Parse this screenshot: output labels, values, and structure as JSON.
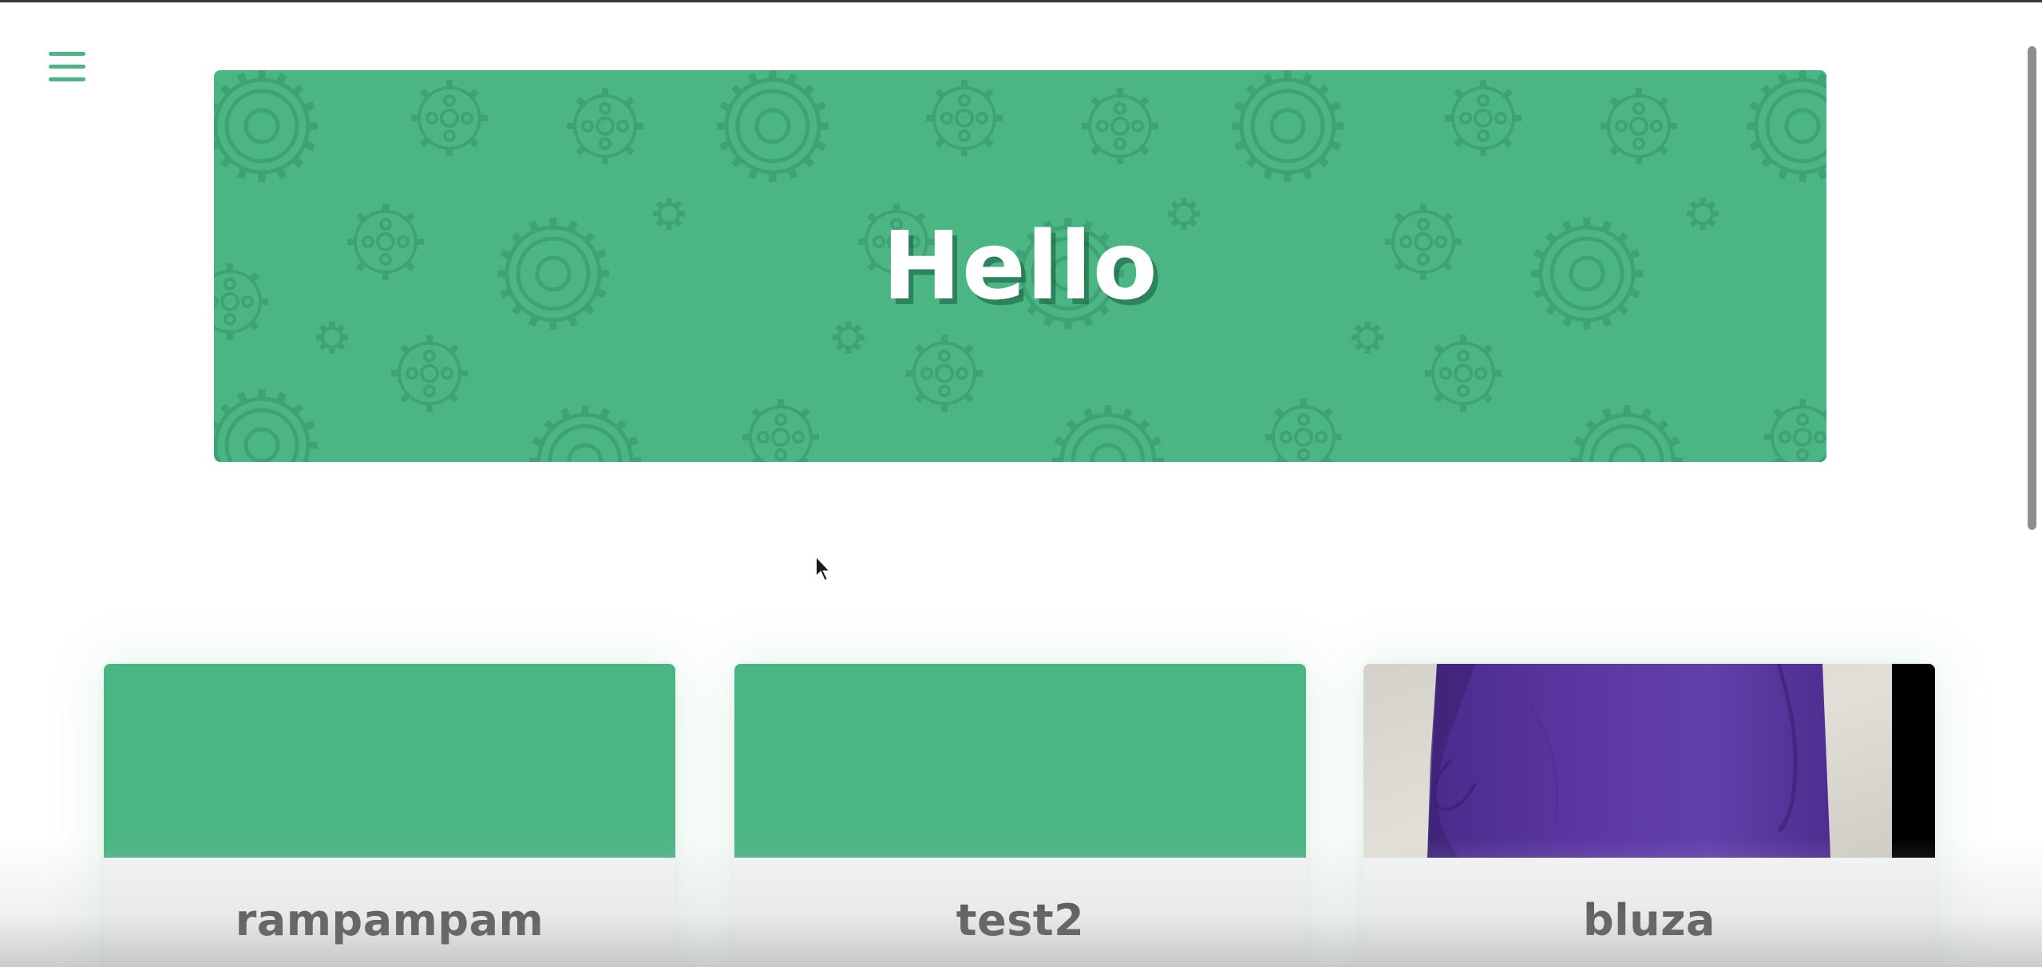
{
  "header": {
    "menu_icon": "hamburger-menu-icon"
  },
  "hero": {
    "title": "Hello",
    "background_color": "#4bb584",
    "pattern": "gear-pattern"
  },
  "cards": [
    {
      "title": "rampampam",
      "image": "green-placeholder"
    },
    {
      "title": "test2",
      "image": "green-placeholder"
    },
    {
      "title": "bluza",
      "image": "purple-sweatshirt-photo"
    }
  ],
  "colors": {
    "accent": "#4bb584",
    "text": "#2b2b2b"
  }
}
